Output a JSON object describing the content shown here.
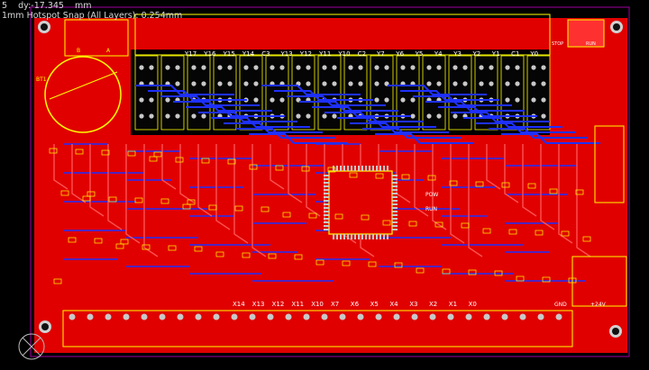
{
  "hud": {
    "line1": "5    dy:-17.345    mm",
    "line2": "1mm Hotspot Snap (All Layers): 0.254mm"
  },
  "labels": {
    "stop": "STOP",
    "run": "RUN",
    "pow": "POW",
    "run2": "RUN",
    "gnd": "GND",
    "v24": "+24V",
    "bt1": "BT1",
    "b": "B",
    "a": "A"
  },
  "top_channels": [
    "Y17",
    "Y16",
    "Y15",
    "Y14",
    "C3",
    "Y13",
    "Y12",
    "Y11",
    "Y10",
    "C2",
    "Y7",
    "Y6",
    "Y5",
    "Y4",
    "Y3",
    "Y2",
    "Y1",
    "C1",
    "Y0"
  ],
  "bottom_inputs": [
    "X14",
    "X13",
    "X12",
    "X11",
    "X10",
    "X7",
    "X6",
    "X5",
    "X4",
    "X3",
    "X2",
    "X1",
    "X0"
  ],
  "colors": {
    "board": "#e00000",
    "top_copper": "#ff1a1a",
    "bottom_copper": "#1e30ff",
    "silkscreen": "#ffff00",
    "pad": "#c8c8c8",
    "outline": "#a000a0",
    "background": "#000000"
  },
  "icons": [
    "mounting-hole-icon",
    "origin-marker-icon"
  ]
}
